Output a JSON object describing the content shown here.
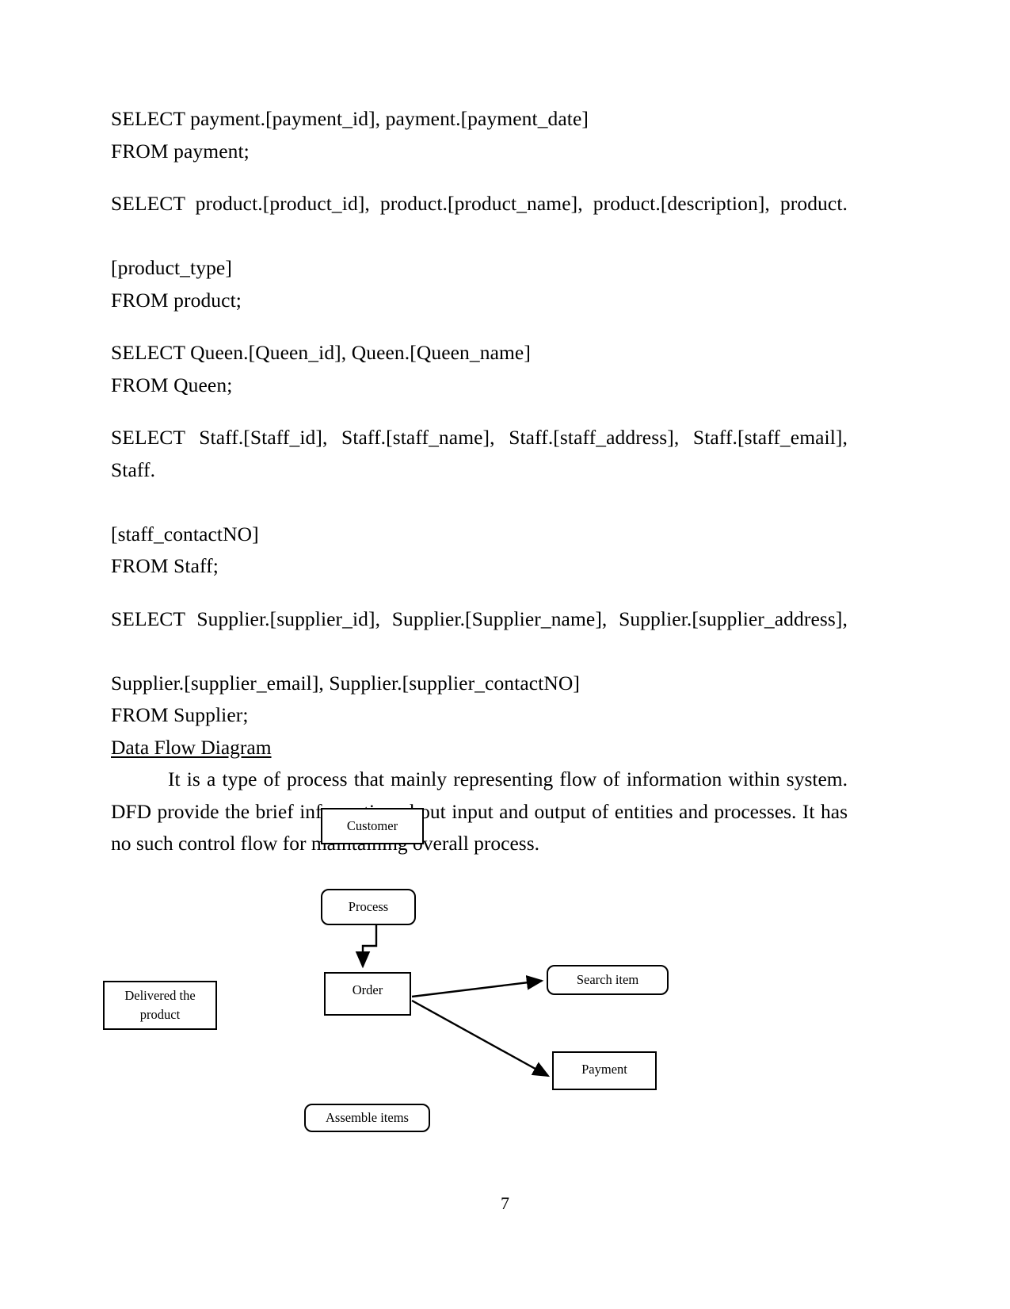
{
  "document": {
    "page_number": "7",
    "sql_statements": [
      {
        "id": "payment",
        "select_line": "SELECT payment.[payment_id], payment.[payment_date]",
        "continuation": "",
        "from_line": "FROM payment;"
      },
      {
        "id": "product",
        "select_line": "SELECT product.[product_id], product.[product_name], product.[description], product.",
        "continuation": "[product_type]",
        "from_line": "FROM product;"
      },
      {
        "id": "queen",
        "select_line": "SELECT Queen.[Queen_id], Queen.[Queen_name]",
        "continuation": "",
        "from_line": "FROM Queen;"
      },
      {
        "id": "staff",
        "select_line": "SELECT Staff.[Staff_id], Staff.[staff_name], Staff.[staff_address], Staff.[staff_email], Staff.",
        "continuation": "[staff_contactNO]",
        "from_line": "FROM Staff;"
      },
      {
        "id": "supplier",
        "select_line": "SELECT Supplier.[supplier_id], Supplier.[Supplier_name], Supplier.[supplier_address],",
        "continuation": "Supplier.[supplier_email], Supplier.[supplier_contactNO]",
        "from_line": "FROM Supplier;"
      }
    ],
    "section": {
      "heading": "Data Flow Diagram",
      "paragraph": "It is a type of process that mainly representing flow of information within system. DFD provide the brief information about input and output of entities and processes. It has no such control flow for maintaining overall process."
    },
    "diagram": {
      "title": "Data Flow Diagram",
      "nodes": [
        {
          "id": "customer",
          "label": "Customer",
          "shape": "rectangle"
        },
        {
          "id": "process",
          "label": "Process",
          "shape": "rounded-rectangle"
        },
        {
          "id": "order",
          "label": "Order",
          "shape": "rectangle"
        },
        {
          "id": "search",
          "label": "Search item",
          "shape": "rounded-rectangle"
        },
        {
          "id": "payment",
          "label": "Payment",
          "shape": "rectangle"
        },
        {
          "id": "delivered",
          "label": "Delivered the product",
          "shape": "rectangle"
        },
        {
          "id": "assemble",
          "label": "Assemble items",
          "shape": "rounded-rectangle"
        }
      ],
      "edges": [
        {
          "from": "process",
          "to": "order",
          "style": "elbow-arrow"
        },
        {
          "from": "order",
          "to": "search",
          "style": "straight-arrow"
        },
        {
          "from": "order",
          "to": "payment",
          "style": "straight-arrow"
        }
      ],
      "line_color": "#000000"
    }
  }
}
